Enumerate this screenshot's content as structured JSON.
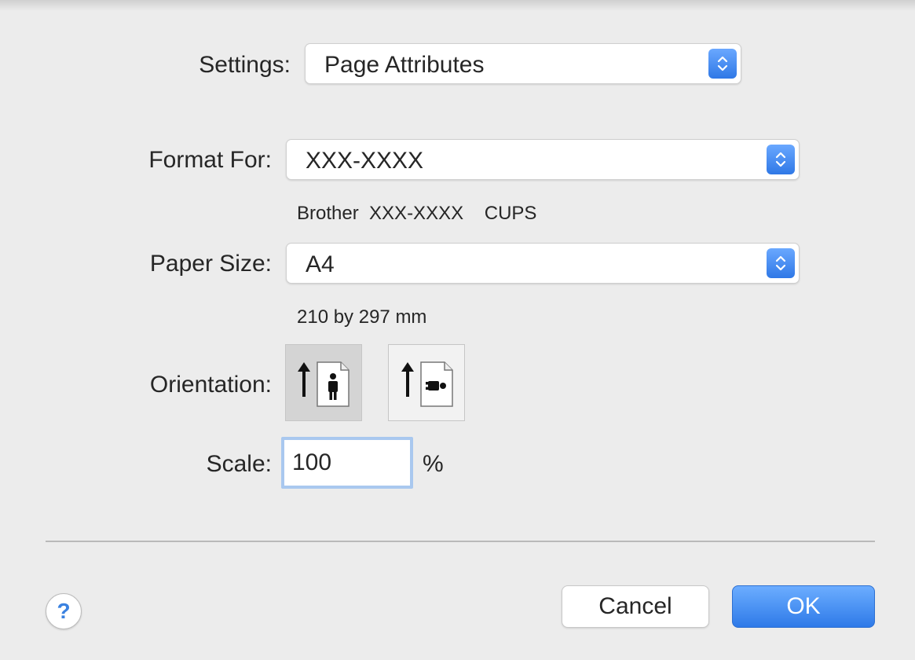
{
  "settings": {
    "label": "Settings:",
    "value": "Page Attributes"
  },
  "format_for": {
    "label": "Format For:",
    "value": "XXX-XXXX",
    "description": "Brother  XXX-XXXX    CUPS"
  },
  "paper_size": {
    "label": "Paper Size:",
    "value": "A4",
    "description": "210 by 297 mm"
  },
  "orientation": {
    "label": "Orientation:",
    "options": [
      "portrait-icon",
      "landscape-icon"
    ],
    "selected": "portrait"
  },
  "scale": {
    "label": "Scale:",
    "value": "100",
    "unit": "%"
  },
  "buttons": {
    "help": "?",
    "cancel": "Cancel",
    "ok": "OK"
  },
  "colors": {
    "accent": "#3b82e0",
    "background": "#ececec"
  }
}
